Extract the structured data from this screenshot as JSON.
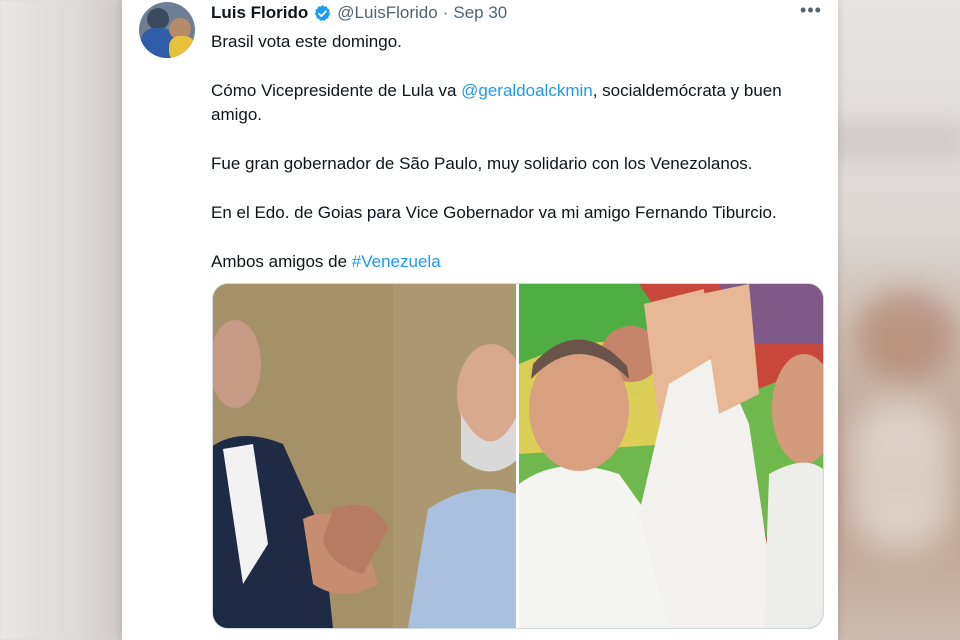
{
  "tweet": {
    "display_name": "Luis Florido",
    "handle": "@LuisFlorido",
    "separator": "·",
    "date": "Sep 30",
    "more_label": "•••",
    "paragraphs": [
      {
        "before": "Brasil vota este domingo.",
        "link": "",
        "after": ""
      },
      {
        "before": "Cómo Vicepresidente de Lula va ",
        "link": "@geraldoalckmin",
        "after": ", socialdemócrata y buen amigo."
      },
      {
        "before": "Fue gran gobernador de São Paulo, muy solidario con los Venezolanos.",
        "link": "",
        "after": ""
      },
      {
        "before": "En el Edo. de Goias para Vice Gobernador va mi amigo Fernando Tiburcio.",
        "link": "",
        "after": ""
      },
      {
        "before": "Ambos amigos de ",
        "link": "#Venezuela",
        "after": ""
      }
    ]
  },
  "colors": {
    "link": "#1d9bf0",
    "verified": "#1d9bf0",
    "text": "#0f1419",
    "secondary": "#536471"
  },
  "icons": {
    "verified": "verified-badge-icon",
    "more": "more-horizontal-icon"
  }
}
